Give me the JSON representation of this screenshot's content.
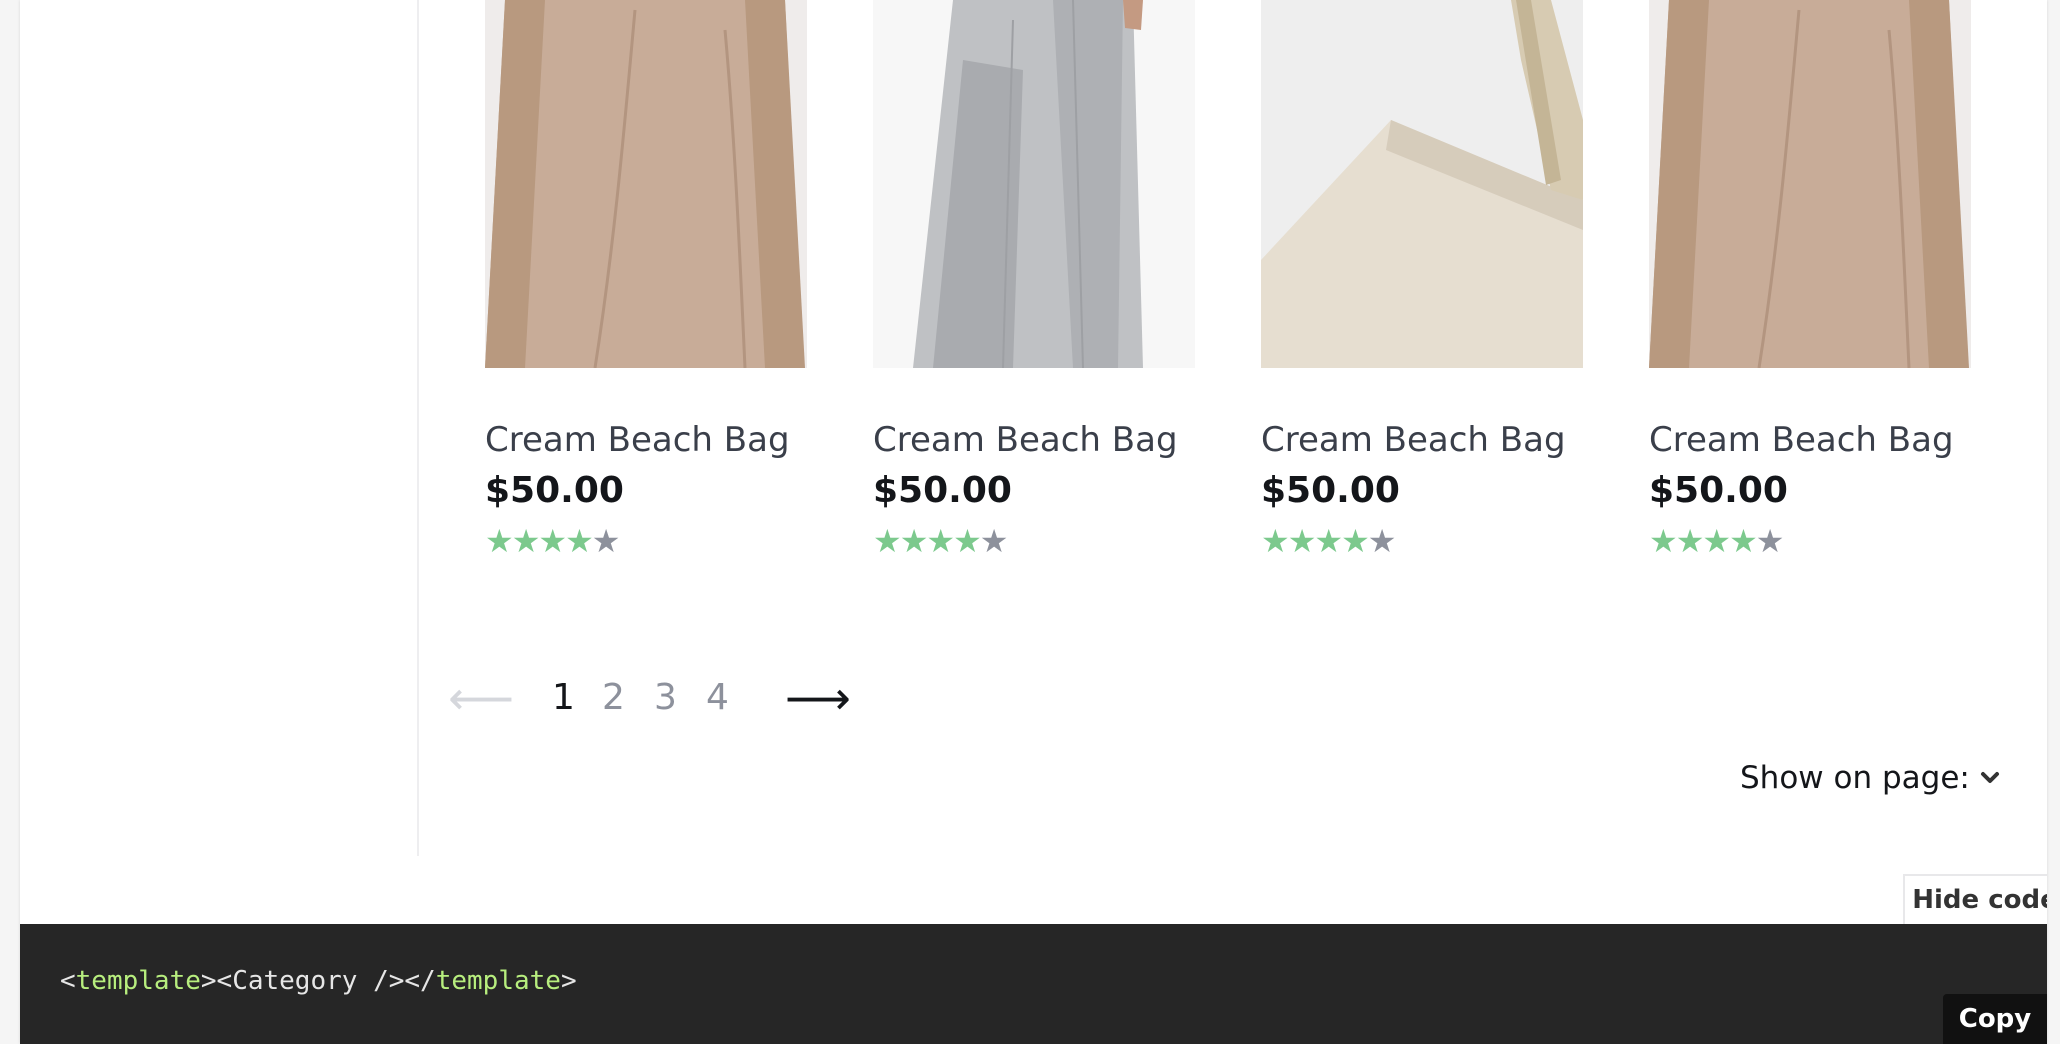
{
  "products": [
    {
      "name": "Cream Beach Bag",
      "price": "$50.00",
      "rating": 4,
      "max_rating": 5,
      "image": "beige-sweater-dress"
    },
    {
      "name": "Cream Beach Bag",
      "price": "$50.00",
      "rating": 4,
      "max_rating": 5,
      "image": "grey-shirt-dress"
    },
    {
      "name": "Cream Beach Bag",
      "price": "$50.00",
      "rating": 4,
      "max_rating": 5,
      "image": "cream-canvas-bag"
    },
    {
      "name": "Cream Beach Bag",
      "price": "$50.00",
      "rating": 4,
      "max_rating": 5,
      "image": "beige-sweater-dress"
    }
  ],
  "pagination": {
    "prev_icon": "arrow-left-icon",
    "next_icon": "arrow-right-icon",
    "pages": [
      "1",
      "2",
      "3",
      "4"
    ],
    "current": "1"
  },
  "show_on_page": {
    "label": "Show on page:",
    "value": "",
    "icon": "chevron-down-icon"
  },
  "code_panel": {
    "hide_label": "Hide code",
    "copy_label": "Copy",
    "code_open_bracket": "<",
    "code_tag": "template",
    "code_inner": "><Category /></",
    "code_close_bracket": ">"
  },
  "colors": {
    "star_filled": "#7cc98d",
    "star_empty": "#8d919c",
    "code_background": "#262626",
    "code_tag": "#b7ee7e"
  }
}
